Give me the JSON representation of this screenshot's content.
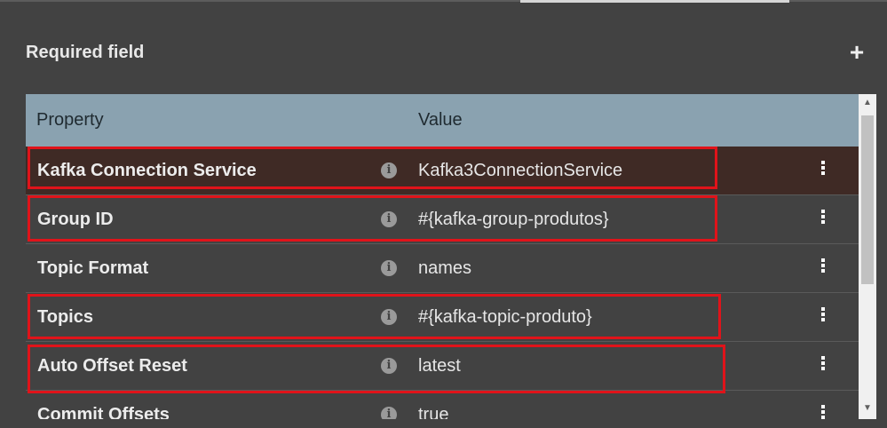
{
  "section": {
    "title": "Required field",
    "add_label": "+"
  },
  "table": {
    "columns": {
      "property": "Property",
      "value": "Value"
    },
    "rows": [
      {
        "property": "Kafka Connection Service",
        "value": "Kafka3ConnectionService",
        "selected": true,
        "highlighted": true
      },
      {
        "property": "Group ID",
        "value": "#{kafka-group-produtos}",
        "selected": false,
        "highlighted": true
      },
      {
        "property": "Topic Format",
        "value": "names",
        "selected": false,
        "highlighted": false
      },
      {
        "property": "Topics",
        "value": "#{kafka-topic-produto}",
        "selected": false,
        "highlighted": true
      },
      {
        "property": "Auto Offset Reset",
        "value": "latest",
        "selected": false,
        "highlighted": true
      },
      {
        "property": "Commit Offsets",
        "value": "true",
        "selected": false,
        "highlighted": false
      }
    ],
    "info_icon_glyph": "i"
  },
  "colors": {
    "background": "#424242",
    "header": "#8aa2b0",
    "selected_row": "#3f2a25",
    "highlight_border": "#e0131a"
  },
  "icons": {
    "add": "plus-icon",
    "info": "info-icon",
    "row_menu": "kebab-menu-icon",
    "scroll_up": "arrow-up-icon",
    "scroll_down": "arrow-down-icon"
  }
}
